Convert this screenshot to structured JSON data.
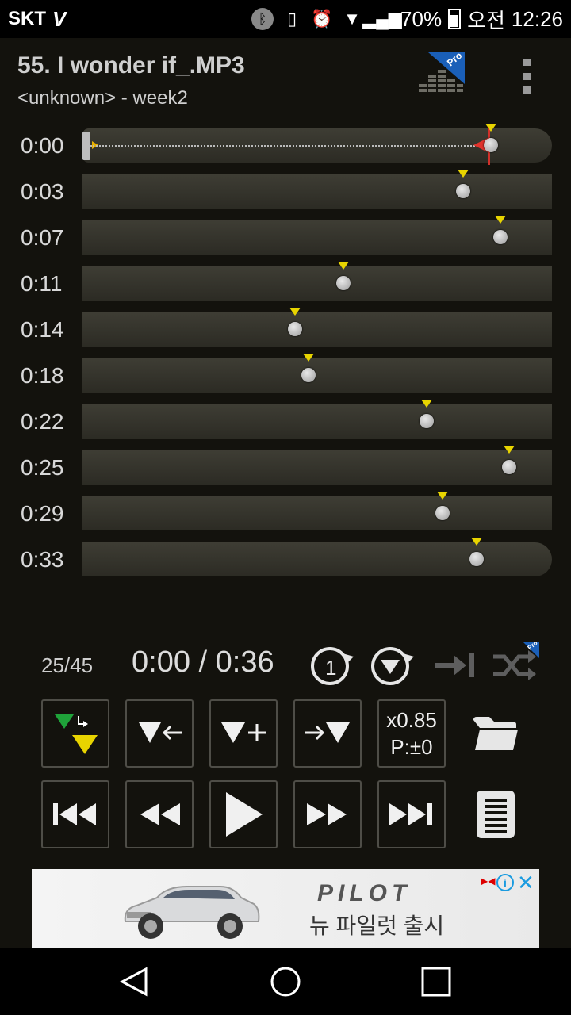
{
  "status_bar": {
    "carrier": "SKT",
    "carrier_icon": "V",
    "battery_percent": "70%",
    "ampm": "오전",
    "time": "12:26",
    "icons": [
      "bluetooth-icon",
      "vibrate-icon",
      "alarm-icon",
      "wifi-icon",
      "signal-icon",
      "battery-icon"
    ]
  },
  "header": {
    "title": "55. I wonder if_.MP3",
    "subtitle": "<unknown> - week2",
    "pro_badge": "Pro"
  },
  "sections": [
    {
      "time": "0:00",
      "marker": 0.87
    },
    {
      "time": "0:03",
      "marker": 0.81
    },
    {
      "time": "0:07",
      "marker": 0.89
    },
    {
      "time": "0:11",
      "marker": 0.555
    },
    {
      "time": "0:14",
      "marker": 0.452
    },
    {
      "time": "0:18",
      "marker": 0.482
    },
    {
      "time": "0:22",
      "marker": 0.733
    },
    {
      "time": "0:25",
      "marker": 0.908
    },
    {
      "time": "0:29",
      "marker": 0.767
    },
    {
      "time": "0:33",
      "marker": 0.84
    }
  ],
  "transport": {
    "counter": "25/45",
    "timer": "0:00 / 0:36",
    "repeat_one_label": "1",
    "pro_badge": "Pro"
  },
  "buttons": {
    "speed_line1": "x0.85",
    "speed_line2": "P:±0"
  },
  "ad": {
    "brand": "PILOT",
    "tagline": "뉴 파일럿 출시"
  },
  "colors": {
    "background": "#13120d",
    "bar": "#35342c",
    "marker_yellow": "#e8d400",
    "end_red": "#e0332c",
    "ad_accent": "#1a9be0"
  }
}
